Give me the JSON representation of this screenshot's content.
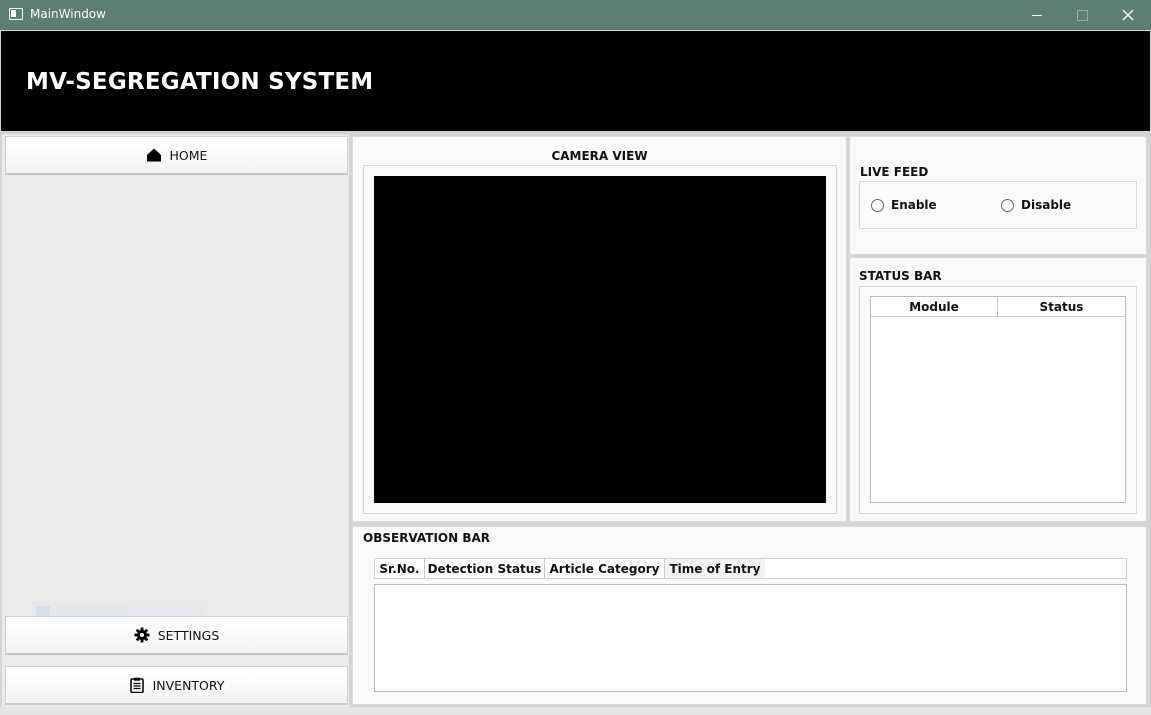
{
  "window": {
    "title": "MainWindow"
  },
  "header": {
    "title": "MV-SEGREGATION SYSTEM"
  },
  "sidebar": {
    "items": [
      {
        "label": "HOME",
        "icon": "home-icon"
      },
      {
        "label": "SETTINGS",
        "icon": "gear-icon"
      },
      {
        "label": "INVENTORY",
        "icon": "clipboard-icon"
      }
    ]
  },
  "camera_view": {
    "title": "CAMERA VIEW"
  },
  "live_feed": {
    "title": "LIVE FEED",
    "options": [
      "Enable",
      "Disable"
    ]
  },
  "status_bar": {
    "title": "STATUS BAR",
    "columns": [
      "Module",
      "Status"
    ]
  },
  "observation_bar": {
    "title": "OBSERVATION BAR",
    "columns": [
      "Sr.No.",
      "Detection Status",
      "Article Category",
      "Time of Entry"
    ]
  },
  "colors": {
    "titlebar": "#5a7f72",
    "header_bg": "#000000",
    "header_text": "#ffffff"
  }
}
